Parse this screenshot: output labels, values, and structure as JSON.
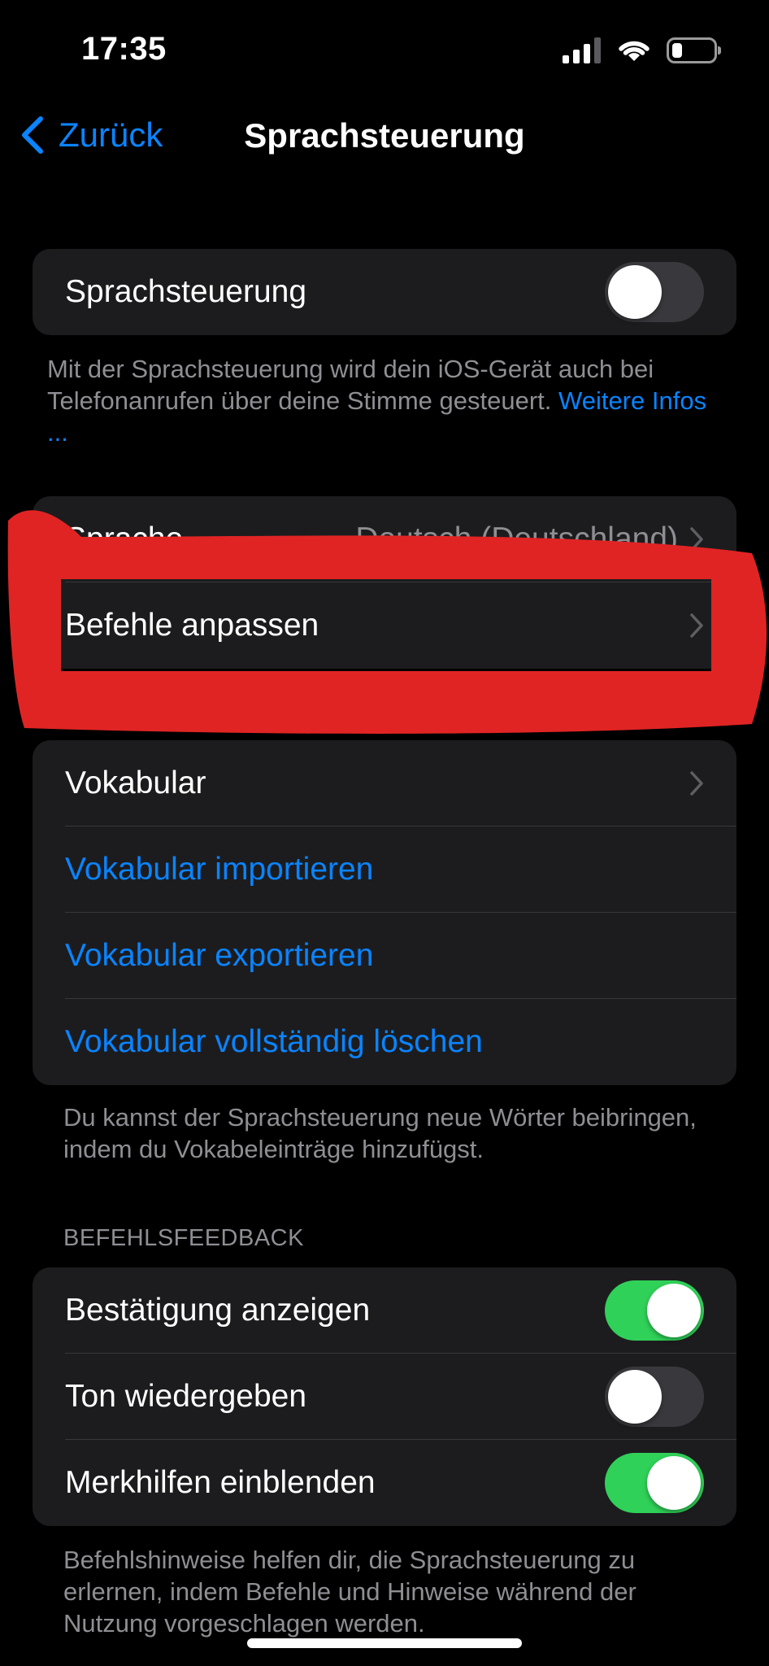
{
  "status_bar": {
    "time": "17:35",
    "battery_level_percent": 25
  },
  "nav": {
    "back_label": "Zurück",
    "title": "Sprachsteuerung"
  },
  "main_toggle": {
    "label": "Sprachsteuerung",
    "state": "off"
  },
  "main_footer": {
    "text": "Mit der Sprachsteuerung wird dein iOS-Gerät auch bei Telefonanrufen über deine Stimme gesteuert. ",
    "link": "Weitere Infos ..."
  },
  "group2": {
    "language_row_label": "Sprache",
    "language_row_value": "Deutsch (Deutschland)",
    "commands_row_label": "Befehle anpassen"
  },
  "vocab": {
    "items": [
      {
        "label": "Vokabular",
        "type": "nav"
      },
      {
        "label": "Vokabular importieren",
        "type": "link"
      },
      {
        "label": "Vokabular exportieren",
        "type": "link"
      },
      {
        "label": "Vokabular vollständig löschen",
        "type": "link"
      }
    ],
    "footer": "Du kannst der Sprachsteuerung neue Wörter beibringen, indem du Vokabeleinträge hinzufügst."
  },
  "feedback": {
    "header": "BEFEHLSFEEDBACK",
    "items": [
      {
        "label": "Bestätigung anzeigen",
        "state": "on"
      },
      {
        "label": "Ton wiedergeben",
        "state": "off"
      },
      {
        "label": "Merkhilfen einblenden",
        "state": "on"
      }
    ],
    "footer": "Befehlshinweise helfen dir, die Sprachsteuerung zu erlernen, indem Befehle und Hinweise während der Nutzung vorgeschlagen werden."
  },
  "colors": {
    "accent": "#0a84ff",
    "toggle_on": "#30d158",
    "cell_bg": "#1c1c1e",
    "annotation_red": "#e02424"
  },
  "icons": [
    "signal-icon",
    "wifi-icon",
    "battery-icon",
    "back-chevron-icon",
    "chevron-right-icon"
  ]
}
